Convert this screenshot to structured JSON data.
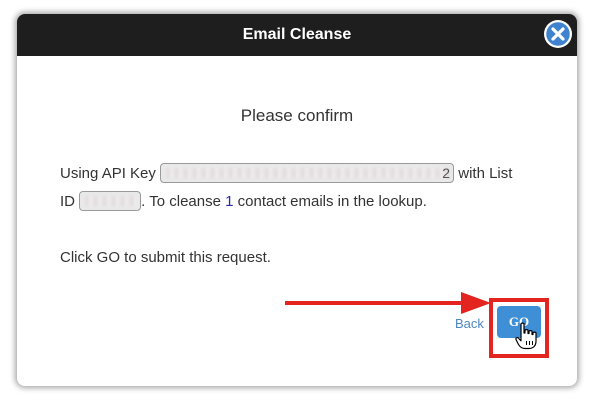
{
  "dialog": {
    "title": "Email Cleanse",
    "heading": "Please confirm",
    "line1": {
      "prefix": "Using API Key",
      "api_key_suffix": "2",
      "middle": "with List",
      "id_label": "ID",
      "after_id": ". To cleanse",
      "count": "1",
      "suffix": "contact emails in the lookup."
    },
    "instruction": "Click GO to submit this request.",
    "back_label": "Back",
    "go_label": "GO",
    "close_icon": "close-icon"
  },
  "colors": {
    "titlebar": "#1e1e1e",
    "go_button": "#3f8fd6",
    "highlight": "#e4241f",
    "link": "#4a86c2",
    "count": "#2a2aa8"
  }
}
